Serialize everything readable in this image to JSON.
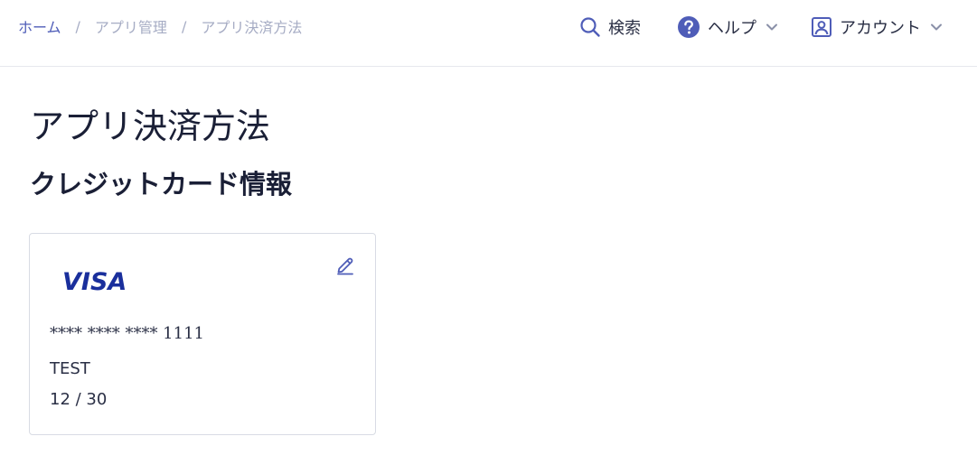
{
  "breadcrumb": {
    "items": [
      "ホーム",
      "アプリ管理",
      "アプリ決済方法"
    ],
    "separator": "/"
  },
  "nav": {
    "search_label": "検索",
    "help_label": "ヘルプ",
    "account_label": "アカウント"
  },
  "page": {
    "title": "アプリ決済方法",
    "section_title": "クレジットカード情報"
  },
  "card": {
    "brand": "VISA",
    "number": "**** **** **** 1111",
    "holder": "TEST",
    "expiry": "12 / 30"
  },
  "colors": {
    "accent": "#4f5db8",
    "brand_blue": "#1a2f9c",
    "text": "#1a1f36",
    "muted": "#a6acc4",
    "border": "#d8dbe4"
  },
  "icons": {
    "search": "search-icon",
    "help": "help-circle-icon",
    "account": "account-icon",
    "chevron": "chevron-down-icon",
    "edit": "pencil-icon"
  }
}
